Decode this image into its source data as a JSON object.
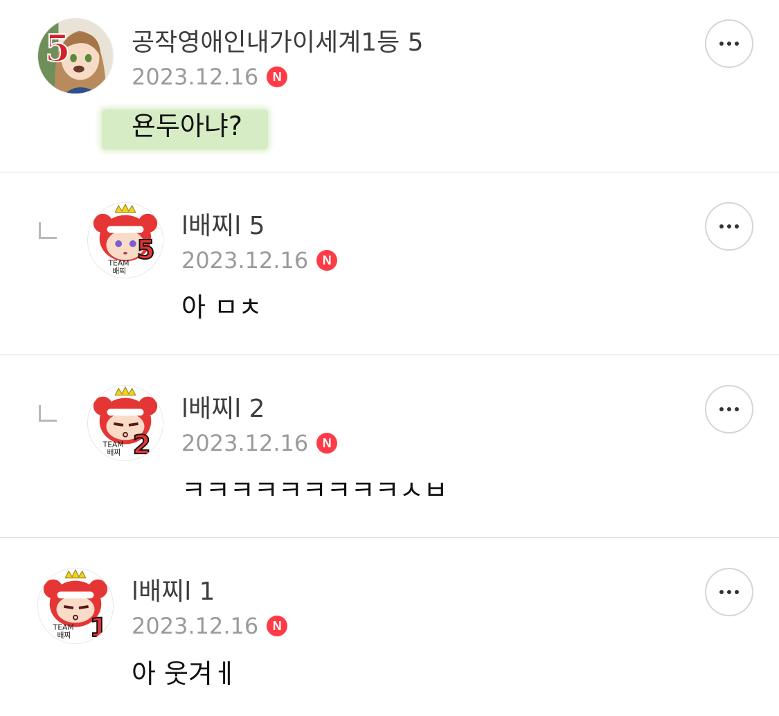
{
  "comments": [
    {
      "author": "공작영애인내가이세계1등 5",
      "date": "2023.12.16",
      "badge": "N",
      "text": "욘두아냐?",
      "highlighted": true,
      "is_reply": false,
      "avatar_number": "5",
      "avatar_label": "anime-girl-avatar",
      "highlight_color": "#d6ecc4"
    },
    {
      "author": "l배찌l 5",
      "date": "2023.12.16",
      "badge": "N",
      "text": "아 ㅁㅊ",
      "is_reply": true,
      "avatar_number": "5",
      "avatar_team": "TEAM",
      "avatar_name": "배찌"
    },
    {
      "author": "l배찌l 2",
      "date": "2023.12.16",
      "badge": "N",
      "text": "ㅋㅋㅋㅋㅋㅋㅋㅋㅋㅅㅂ",
      "is_reply": true,
      "avatar_number": "2",
      "avatar_team": "TEAM",
      "avatar_name": "배찌"
    },
    {
      "author": "l배찌l 1",
      "date": "2023.12.16",
      "badge": "N",
      "text": "아 웃겨ㅔ",
      "is_reply": false,
      "avatar_number": "1",
      "avatar_team": "TEAM",
      "avatar_name": "배찌"
    }
  ],
  "colors": {
    "badge": "#ff3b47",
    "author": "#3d3d3d",
    "date": "#9a9a9a",
    "divider": "#dcdcdc"
  },
  "icons": {
    "more": "more-options-icon",
    "reply": "reply-indent-icon",
    "new": "new-badge-icon"
  }
}
